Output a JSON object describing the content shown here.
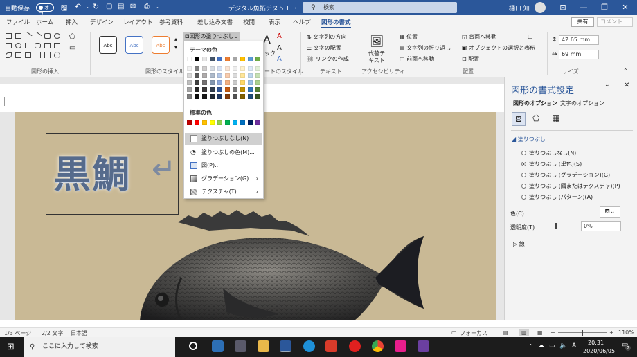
{
  "titlebar": {
    "autosave_label": "自動保存",
    "autosave_state": "オフ",
    "doc_title": "デジタル魚拓チヌ５１ ・",
    "search_placeholder": "検索",
    "user_name": "樋口 知一"
  },
  "tabs": [
    "ファイル",
    "ホーム",
    "挿入",
    "デザイン",
    "レイアウト",
    "参考資料",
    "差し込み文書",
    "校閲",
    "表示",
    "ヘルプ",
    "図形の書式"
  ],
  "tabs_right": {
    "share": "共有",
    "comment": "コメント"
  },
  "ribbon": {
    "groups": {
      "insert_shapes": "図形の挿入",
      "shape_styles": "図形のスタイル",
      "wordart_styles": "ートのスタイル",
      "text": "テキスト",
      "accessibility": "アクセシビリティ",
      "arrange": "配置",
      "size": "サイズ"
    },
    "style_samples": [
      "Abc",
      "Abc",
      "Abc"
    ],
    "fill_button": "図形の塗りつぶし",
    "wordart_label": "ック",
    "text_direction": "文字列の方向",
    "align_text": "文字の配置",
    "create_link": "リンクの作成",
    "alt_text": "代替テ\nキスト",
    "alt_text_1": "代替テ",
    "alt_text_2": "キスト",
    "position": "位置",
    "wrap_text": "文字列の折り返し",
    "bring_forward": "前面へ移動",
    "send_backward": "背面へ移動",
    "selection_pane": "オブジェクトの選択と表示",
    "align": "配置",
    "height": "42.65 mm",
    "width": "69 mm"
  },
  "fill_menu": {
    "theme_colors_label": "テーマの色",
    "standard_colors_label": "標準の色",
    "theme_top_row": [
      "#ffffff",
      "#000000",
      "#e7e6e6",
      "#44546a",
      "#4472c4",
      "#ed7d31",
      "#a5a5a5",
      "#ffc000",
      "#5b9bd5",
      "#70ad47"
    ],
    "theme_shades": [
      [
        "#f2f2f2",
        "#7f7f7f",
        "#d0cece",
        "#d6dce4",
        "#d9e2f3",
        "#fbe5d6",
        "#ededed",
        "#fff2cc",
        "#deebf7",
        "#e2f0d9"
      ],
      [
        "#d9d9d9",
        "#595959",
        "#aeabab",
        "#adb9ca",
        "#b4c7e7",
        "#f8cbad",
        "#dbdbdb",
        "#ffe699",
        "#bdd7ee",
        "#c5e0b4"
      ],
      [
        "#bfbfbf",
        "#404040",
        "#757171",
        "#8497b0",
        "#8faadc",
        "#f4b183",
        "#c9c9c9",
        "#ffd966",
        "#9dc3e6",
        "#a9d18e"
      ],
      [
        "#a6a6a6",
        "#262626",
        "#3b3838",
        "#333f50",
        "#2f5597",
        "#c55a11",
        "#7b7b7b",
        "#bf9000",
        "#2e75b6",
        "#548235"
      ],
      [
        "#7f7f7f",
        "#0d0d0d",
        "#171616",
        "#222a35",
        "#1f3864",
        "#843c0c",
        "#525252",
        "#7f6000",
        "#1f4e79",
        "#385723"
      ]
    ],
    "standard_colors": [
      "#c00000",
      "#ff0000",
      "#ffc000",
      "#ffff00",
      "#92d050",
      "#00b050",
      "#00b0f0",
      "#0070c0",
      "#002060",
      "#7030a0"
    ],
    "items": [
      {
        "label": "塗りつぶしなし(N)"
      },
      {
        "label": "塗りつぶしの色(M)..."
      },
      {
        "label": "図(P)..."
      },
      {
        "label": "グラデーション(G)"
      },
      {
        "label": "テクスチャ(T)"
      }
    ]
  },
  "document": {
    "wordart_text": "黒鯛",
    "paragraph_mark": "↵"
  },
  "pane": {
    "title": "図形の書式設定",
    "tab_shape": "図形のオプション",
    "tab_text": "文字のオプション",
    "fill_section": "塗りつぶし",
    "fill_options": [
      {
        "label": "塗りつぶしなし(N)",
        "selected": false
      },
      {
        "label": "塗りつぶし (単色)(S)",
        "selected": true
      },
      {
        "label": "塗りつぶし (グラデーション)(G)",
        "selected": false
      },
      {
        "label": "塗りつぶし (図またはテクスチャ)(P)",
        "selected": false
      },
      {
        "label": "塗りつぶし (パターン)(A)",
        "selected": false
      }
    ],
    "color_label": "色(C)",
    "transparency_label": "透明度(T)",
    "transparency_value": "0%",
    "line_section": "線"
  },
  "status": {
    "page": "1/3 ページ",
    "words": "2/2 文字",
    "language": "日本語",
    "focus": "フォーカス",
    "zoom": "110%"
  },
  "taskbar": {
    "search_placeholder": "ここに入力して検索",
    "ime": "A",
    "time": "20:31",
    "date": "2020/06/05",
    "notifications": "2"
  }
}
